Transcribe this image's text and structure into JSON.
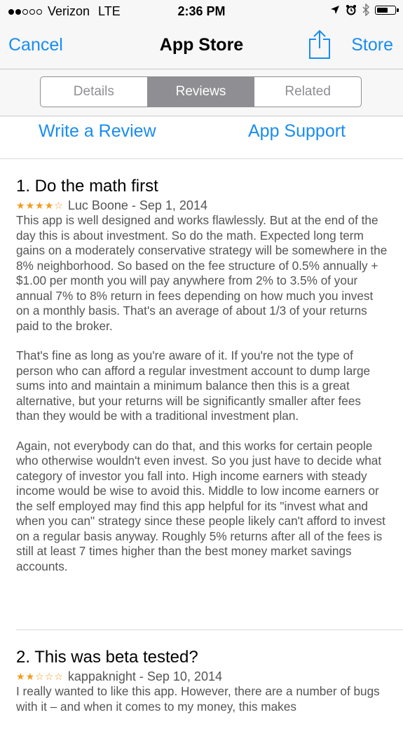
{
  "status_bar": {
    "signal_dots_filled": 2,
    "signal_dots_total": 5,
    "carrier": "Verizon",
    "network": "LTE",
    "time": "2:36 PM",
    "battery_level": 0.65,
    "icons": [
      "location-arrow-icon",
      "alarm-clock-icon",
      "bluetooth-icon",
      "battery-icon"
    ]
  },
  "nav": {
    "cancel_label": "Cancel",
    "title": "App Store",
    "store_label": "Store",
    "share_icon": "share-icon"
  },
  "tabs": {
    "items": [
      "Details",
      "Reviews",
      "Related"
    ],
    "selected": "Reviews"
  },
  "links": {
    "write_review": "Write a Review",
    "app_support": "App Support"
  },
  "colors": {
    "accent": "#1a8cf0",
    "star": "#f29b1d",
    "segment": "#8e8e93"
  },
  "reviews": [
    {
      "title": "1. Do the math first",
      "rating": 4,
      "author_date": "Luc Boone - Sep 1, 2014",
      "paragraphs": [
        "This app is well designed and works flawlessly. But at the end of the day this is about investment. So do the math. Expected long term gains on a moderately conservative strategy will be somewhere in the 8% neighborhood. So based on the fee structure of 0.5% annually + $1.00 per month you will pay anywhere from 2% to 3.5% of your annual 7% to 8% return in fees depending on how much you invest on a monthly basis. That's an average of about 1/3 of your returns paid to the broker.",
        "That's fine as long as you're aware of it. If you're not the type of person who can afford a regular investment account to dump large sums into and maintain a minimum balance then this is a great alternative, but your returns will be significantly smaller after fees than they would be with a traditional investment plan.",
        "Again, not everybody can do that, and this works for certain people who otherwise wouldn't even invest. So you just have to decide what category of investor you fall into. High income earners with steady income would be wise to avoid this. Middle to low income earners or the self employed may find this app helpful for its \"invest what and when you can\" strategy since these people likely can't afford to invest on a regular basis anyway. Roughly 5% returns after all of the fees is still at least 7 times higher than the best money market savings accounts."
      ]
    },
    {
      "title": "2. This was beta tested?",
      "rating": 2,
      "author_date": "kappaknight - Sep 10, 2014",
      "paragraphs": [
        "I really wanted to like this app. However, there are a number of bugs with it – and when it comes to my money, this makes"
      ]
    }
  ]
}
